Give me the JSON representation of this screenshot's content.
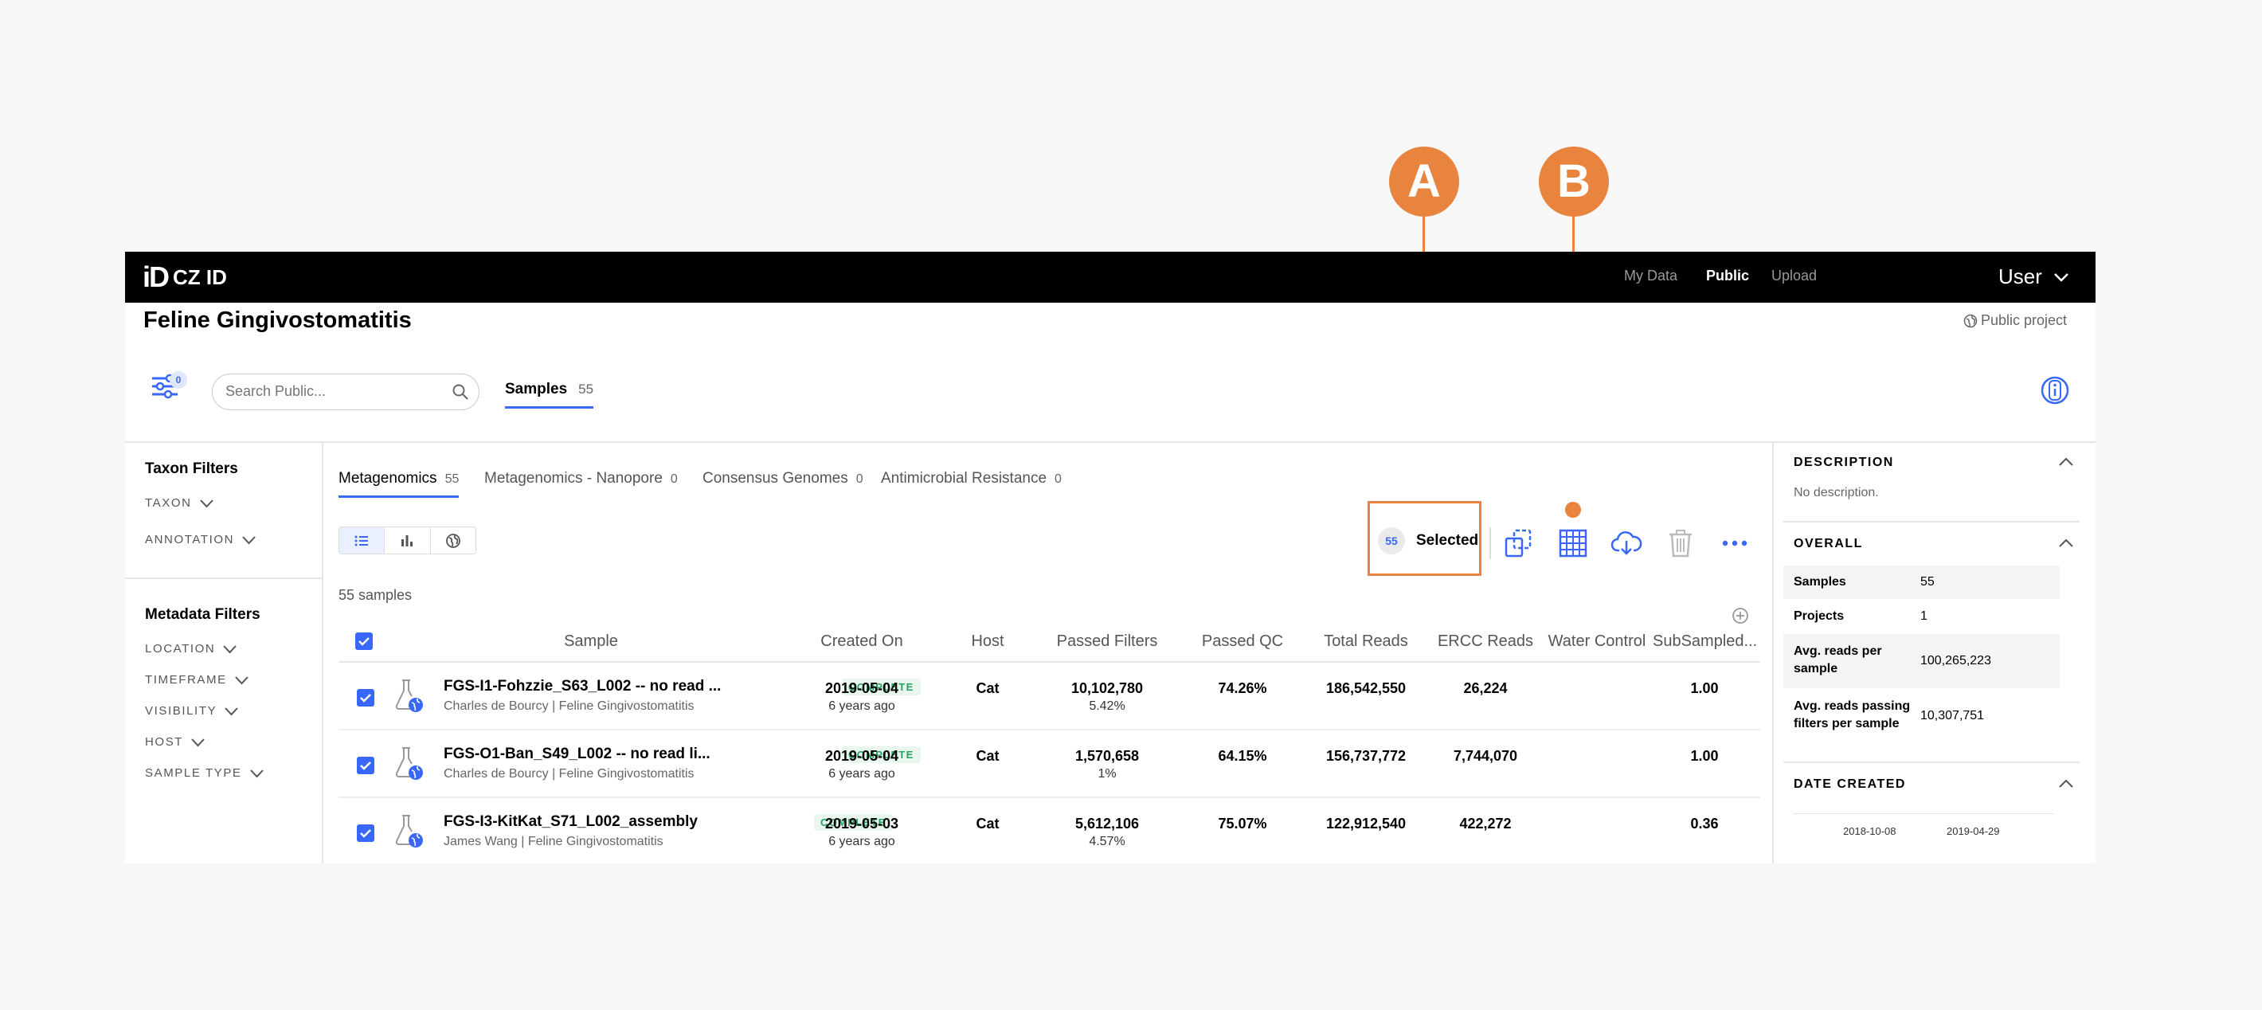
{
  "nav": {
    "logo_mark": "iD",
    "logo_text": "CZ ID",
    "links": [
      "My Data",
      "Public",
      "Upload"
    ],
    "user": "User"
  },
  "header": {
    "project_title": "Feline Gingivostomatitis",
    "public_badge": "Public project",
    "filter_count": "0",
    "search_placeholder": "Search Public...",
    "samples_tab": {
      "label": "Samples",
      "count": "55"
    }
  },
  "filters": {
    "taxon_heading": "Taxon Filters",
    "taxon_items": [
      "TAXON",
      "ANNOTATION"
    ],
    "metadata_heading": "Metadata Filters",
    "metadata_items": [
      "LOCATION",
      "TIMEFRAME",
      "VISIBILITY",
      "HOST",
      "SAMPLE TYPE"
    ]
  },
  "workflow_tabs": [
    {
      "label": "Metagenomics",
      "count": "55"
    },
    {
      "label": "Metagenomics - Nanopore",
      "count": "0"
    },
    {
      "label": "Consensus Genomes",
      "count": "0"
    },
    {
      "label": "Antimicrobial Resistance",
      "count": "0"
    }
  ],
  "selection": {
    "count": "55",
    "label": "Selected"
  },
  "actions": [
    "bulk-kickoff-icon",
    "heatmap-grid-icon",
    "download-cloud-icon",
    "trash-icon",
    "more-icon"
  ],
  "samples_count": "55 samples",
  "table": {
    "columns": [
      "Sample",
      "Created On",
      "Host",
      "Passed Filters",
      "Passed QC",
      "Total Reads",
      "ERCC Reads",
      "Water Control",
      "SubSampled..."
    ],
    "rows": [
      {
        "name": "FGS-I1-Fohzzie_S63_L002 -- no read ...",
        "status": "COMPLETE",
        "meta": "Charles de Bourcy | Feline Gingivostomatitis",
        "created": "2019-05-04",
        "created_ago": "6 years ago",
        "host": "Cat",
        "passed_filters": "10,102,780",
        "passed_filters_pct": "5.42%",
        "passed_qc": "74.26%",
        "total_reads": "186,542,550",
        "ercc_reads": "26,224",
        "water_control": "",
        "subsampled": "1.00"
      },
      {
        "name": "FGS-O1-Ban_S49_L002 -- no read li...",
        "status": "COMPLETE",
        "meta": "Charles de Bourcy | Feline Gingivostomatitis",
        "created": "2019-05-04",
        "created_ago": "6 years ago",
        "host": "Cat",
        "passed_filters": "1,570,658",
        "passed_filters_pct": "1%",
        "passed_qc": "64.15%",
        "total_reads": "156,737,772",
        "ercc_reads": "7,744,070",
        "water_control": "",
        "subsampled": "1.00"
      },
      {
        "name": "FGS-I3-KitKat_S71_L002_assembly",
        "status": "COMPLETE",
        "meta": "James Wang | Feline Gingivostomatitis",
        "created": "2019-05-03",
        "created_ago": "6 years ago",
        "host": "Cat",
        "passed_filters": "5,612,106",
        "passed_filters_pct": "4.57%",
        "passed_qc": "75.07%",
        "total_reads": "122,912,540",
        "ercc_reads": "422,272",
        "water_control": "",
        "subsampled": "0.36"
      }
    ]
  },
  "sidebar": {
    "description_heading": "DESCRIPTION",
    "description_text": "No description.",
    "overall_heading": "OVERALL",
    "stats": [
      {
        "label": "Samples",
        "value": "55"
      },
      {
        "label": "Projects",
        "value": "1"
      },
      {
        "label": "Avg. reads per sample",
        "value": "100,265,223"
      },
      {
        "label": "Avg. reads passing filters per sample",
        "value": "10,307,751"
      }
    ],
    "date_heading": "DATE CREATED",
    "date_range": [
      "2018-10-08",
      "2019-04-29"
    ]
  },
  "callouts": [
    "A",
    "B"
  ],
  "colors": {
    "accent": "#3867fa",
    "callout": "#e8843e",
    "complete": "#23a460"
  }
}
